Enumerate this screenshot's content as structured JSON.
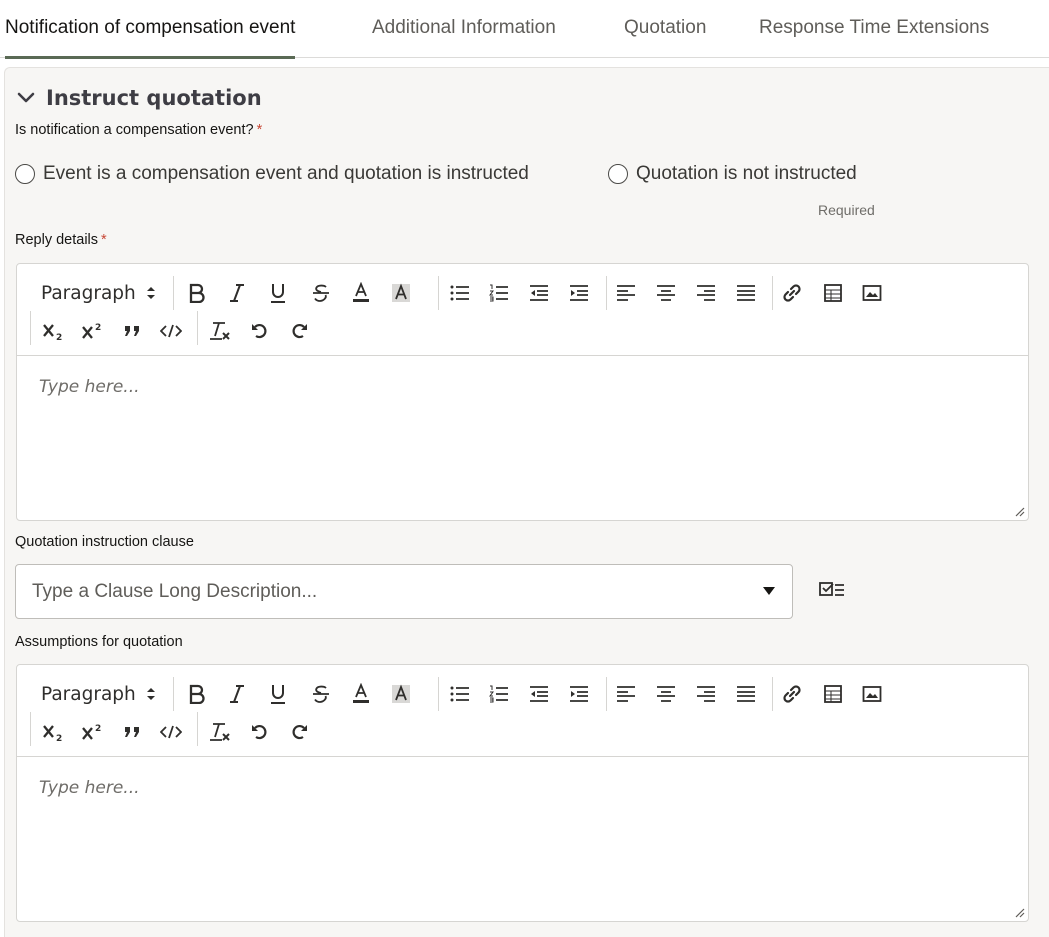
{
  "tabs": [
    {
      "label": "Notification of compensation event",
      "active": true
    },
    {
      "label": "Additional Information",
      "active": false
    },
    {
      "label": "Quotation",
      "active": false
    },
    {
      "label": "Response Time Extensions",
      "active": false
    }
  ],
  "section": {
    "title": "Instruct quotation",
    "question_label": "Is notification a compensation event?",
    "required_mark": "*",
    "options": [
      {
        "label": "Event is a compensation event and quotation is instructed",
        "selected": false
      },
      {
        "label": "Quotation is not instructed",
        "selected": false
      }
    ],
    "required_hint": "Required"
  },
  "reply_details": {
    "label": "Reply details",
    "required_mark": "*",
    "format_select": "Paragraph",
    "placeholder": "Type here..."
  },
  "clause": {
    "label": "Quotation instruction clause",
    "placeholder": "Type a Clause Long Description..."
  },
  "assumptions": {
    "label": "Assumptions for quotation",
    "format_select": "Paragraph",
    "placeholder": "Type here..."
  },
  "toolbar_icons": [
    "paragraph-select",
    "bold-icon",
    "italic-icon",
    "underline-icon",
    "strikethrough-icon",
    "font-color-icon",
    "highlight-icon",
    "bulleted-list-icon",
    "numbered-list-icon",
    "outdent-icon",
    "indent-icon",
    "align-left-icon",
    "align-center-icon",
    "align-right-icon",
    "justify-icon",
    "link-icon",
    "table-icon",
    "image-icon",
    "subscript-icon",
    "superscript-icon",
    "blockquote-icon",
    "code-icon",
    "clear-format-icon",
    "undo-icon",
    "redo-icon"
  ],
  "colors": {
    "accent_tab": "#5a6a55",
    "required": "#c74634",
    "panel_bg": "#f7f6f4"
  }
}
